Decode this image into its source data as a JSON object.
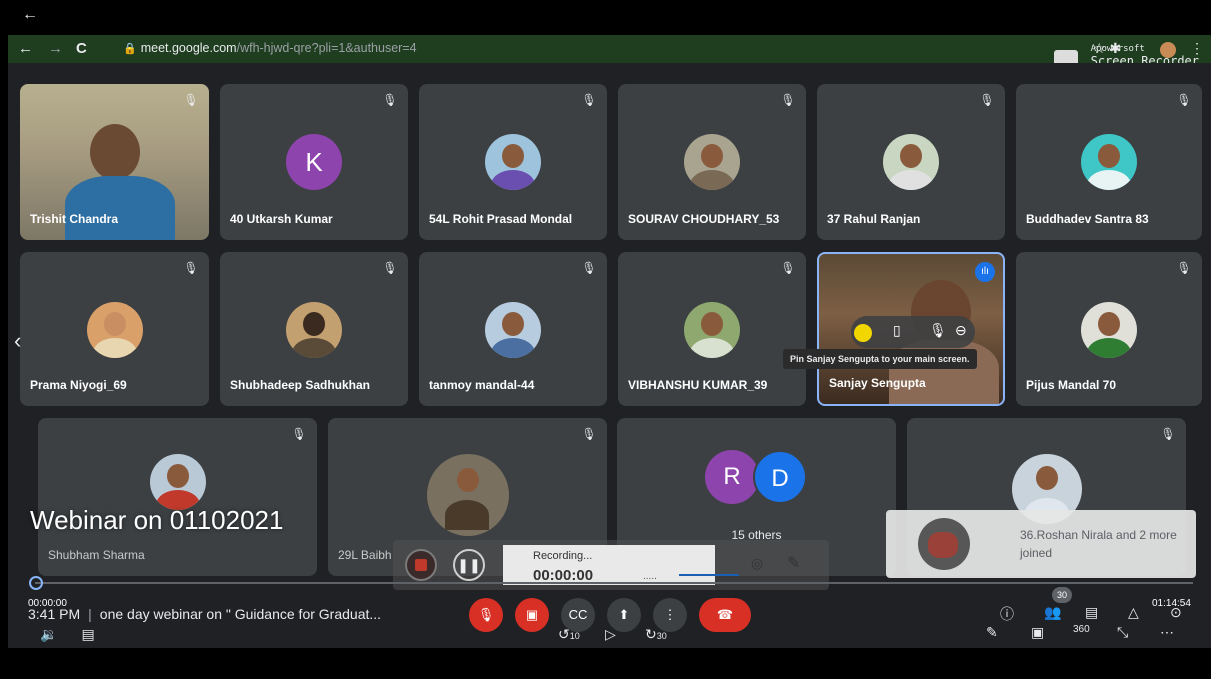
{
  "browser": {
    "url_host": "meet.google.com",
    "url_path": "/wfh-hjwd-qre?pli=1&authuser=4",
    "recorder_brand_small": "Apowersoft",
    "recorder_brand": "Screen Recorder"
  },
  "tiles": [
    {
      "name": "Trishit Chandra"
    },
    {
      "name": "40 Utkarsh Kumar",
      "letter": "K",
      "color": "#8e44ad"
    },
    {
      "name": "54L Rohit Prasad Mondal"
    },
    {
      "name": "SOURAV CHOUDHARY_53"
    },
    {
      "name": "37 Rahul Ranjan"
    },
    {
      "name": "Buddhadev Santra 83"
    },
    {
      "name": "Prama Niyogi_69"
    },
    {
      "name": "Shubhadeep Sadhukhan"
    },
    {
      "name": "tanmoy mandal-44"
    },
    {
      "name": "VIBHANSHU KUMAR_39"
    },
    {
      "name": "Sanjay Sengupta"
    },
    {
      "name": "Pijus Mandal 70"
    },
    {
      "name": "Shubham Sharma"
    },
    {
      "name": "29L Baibh"
    },
    {
      "name": "15 others",
      "letter1": "R",
      "letter2": "D"
    },
    {
      "name": ""
    }
  ],
  "pin_tooltip": "Pin Sanjay Sengupta to your main screen.",
  "video": {
    "title": "Webinar on 01102021",
    "recording_label": "Recording...",
    "recording_time": "00:00:00",
    "recording_dots": ".....",
    "time_start": "00:00:00",
    "time_end": "01:14:54",
    "meeting_time": "3:41 PM",
    "meeting_title": "one day webinar on \" Guidance for Graduat...",
    "progress": 0
  },
  "toast": {
    "message": "36.Roshan Nirala and 2 more joined"
  },
  "participants_badge": "30",
  "controls": {
    "rewind_label": "10",
    "forward_label": "30",
    "vr_label": "360"
  }
}
